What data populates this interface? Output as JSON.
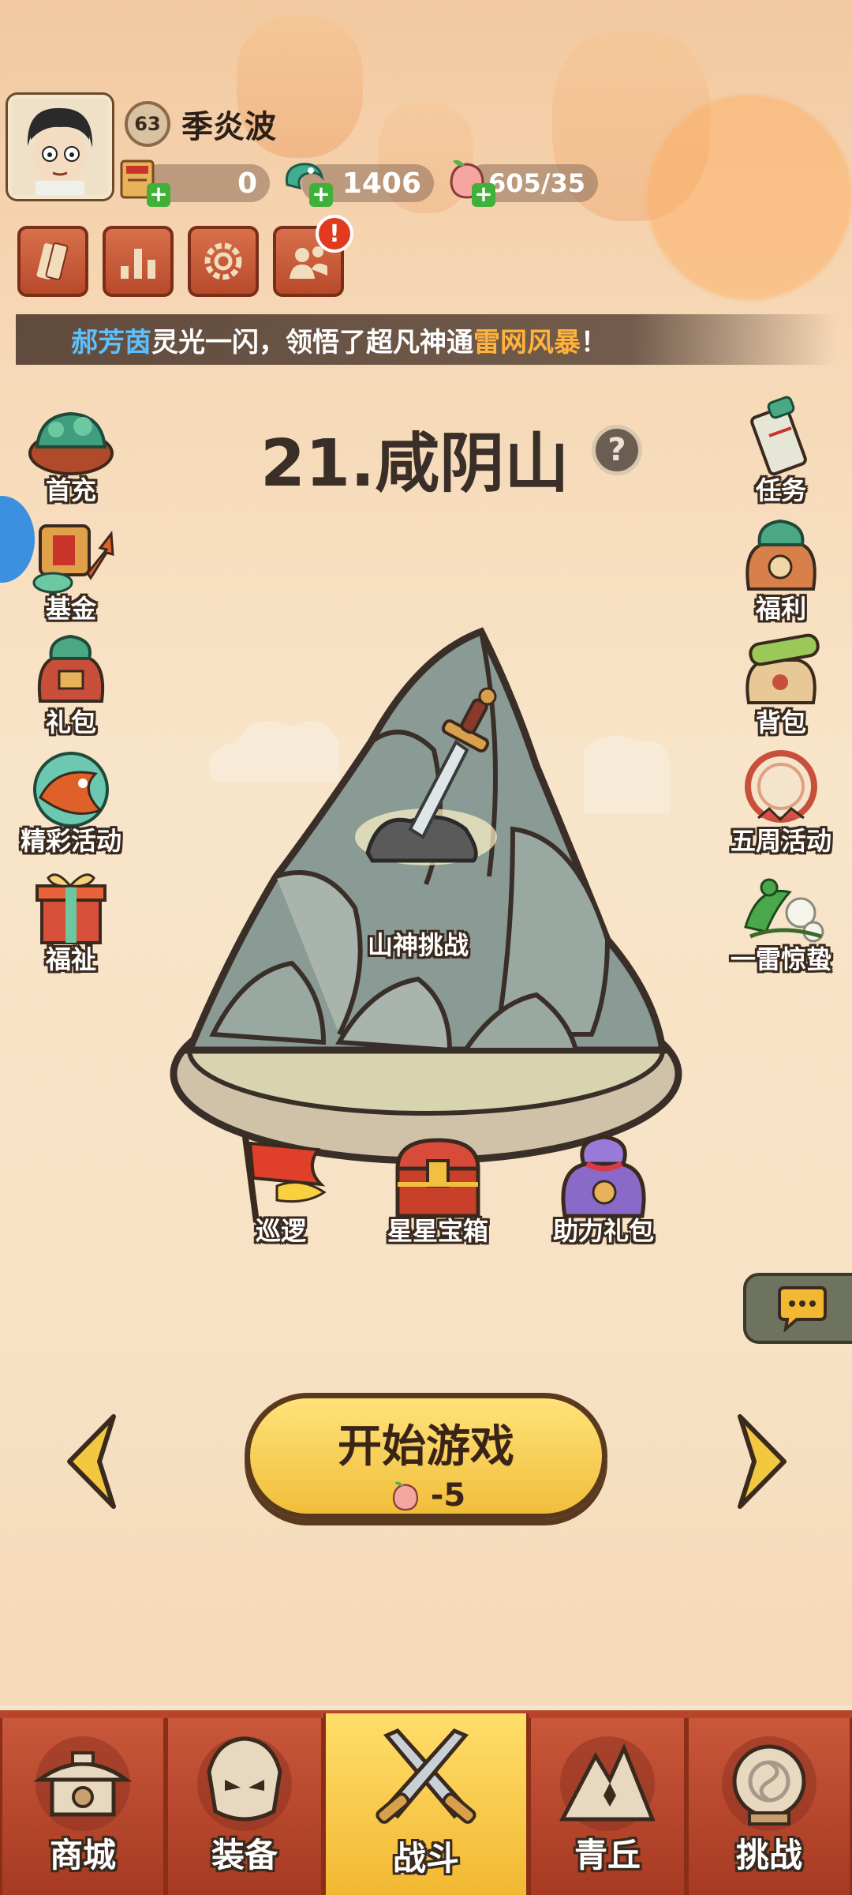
{
  "player": {
    "name": "季炎波",
    "level": "63"
  },
  "resources": [
    {
      "name": "scroll-ticket",
      "value": "0"
    },
    {
      "name": "jade-dragon",
      "value": "1406"
    },
    {
      "name": "peach-stamina",
      "value": "1605/35"
    }
  ],
  "top_buttons": [
    {
      "name": "tickets-icon"
    },
    {
      "name": "rank-chart-icon"
    },
    {
      "name": "settings-gear-icon"
    },
    {
      "name": "friends-icon",
      "alert": "!"
    }
  ],
  "ticker": {
    "player": "郝芳茵",
    "mid": " 灵光一闪，领悟了超凡神通 ",
    "skill": "雷网风暴",
    "end": "！"
  },
  "stage": {
    "title": "21.咸阴山",
    "help": "?",
    "boss_label": "山神挑战"
  },
  "left_menu": [
    {
      "label": "首充",
      "icon": "first-charge-icon"
    },
    {
      "label": "基金",
      "icon": "fund-icon"
    },
    {
      "label": "礼包",
      "icon": "gift-pack-icon"
    },
    {
      "label": "精彩活动",
      "icon": "events-icon"
    },
    {
      "label": "福祉",
      "icon": "blessing-gift-icon"
    }
  ],
  "right_menu": [
    {
      "label": "任务",
      "icon": "quest-scroll-icon"
    },
    {
      "label": "福利",
      "icon": "welfare-bag-icon"
    },
    {
      "label": "背包",
      "icon": "backpack-icon"
    },
    {
      "label": "五周活动",
      "icon": "anniversary-icon"
    },
    {
      "label": "一雷惊蛰",
      "icon": "spring-thunder-icon"
    }
  ],
  "stage_items": [
    {
      "label": "巡逻",
      "icon": "patrol-flag-icon"
    },
    {
      "label": "星星宝箱",
      "icon": "star-chest-icon"
    },
    {
      "label": "助力礼包",
      "icon": "support-bag-icon"
    }
  ],
  "start": {
    "label": "开始游戏",
    "cost": "-5"
  },
  "bottom_nav": [
    {
      "label": "商城",
      "icon": "shop-icon",
      "active": false
    },
    {
      "label": "装备",
      "icon": "equipment-icon",
      "active": false
    },
    {
      "label": "战斗",
      "icon": "battle-swords-icon",
      "active": true
    },
    {
      "label": "青丘",
      "icon": "qingqiu-mountain-icon",
      "active": false
    },
    {
      "label": "挑战",
      "icon": "challenge-icon",
      "active": false
    }
  ],
  "colors": {
    "accent_orange": "#f1be3a",
    "nav_red": "#b8452a",
    "ticker_blue": "#5cc0ff",
    "ticker_orange": "#ffb23c"
  }
}
